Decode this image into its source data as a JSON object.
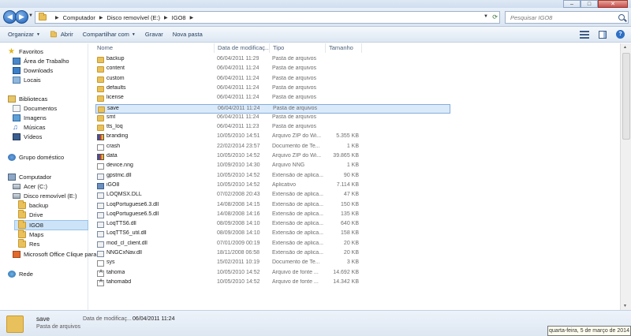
{
  "addressbar": {
    "crumbs": [
      "Computador",
      "Disco removível (E:)",
      "IGO8"
    ],
    "search_placeholder": "Pesquisar IGO8"
  },
  "toolbar": {
    "items": [
      "Organizar",
      "Abrir",
      "Compartilhar com",
      "Gravar",
      "Nova pasta"
    ]
  },
  "window_controls": {
    "minimize": "–",
    "maximize": "□",
    "close": "✕"
  },
  "nav": {
    "favorites": "Favoritos",
    "desktop": "Área de Trabalho",
    "downloads": "Downloads",
    "locais": "Locais",
    "libraries": "Bibliotecas",
    "documents": "Documentos",
    "images": "Imagens",
    "music": "Músicas",
    "videos": "Vídeos",
    "homegroup": "Grupo doméstico",
    "computer": "Computador",
    "drive_c": "Acer (C:)",
    "drive_e": "Disco removível (E:)",
    "folder_backup": "backup",
    "folder_drive": "Drive",
    "folder_igo8": "IGO8",
    "folder_maps": "Maps",
    "folder_res": "Res",
    "office": "Microsoft Office Clique para",
    "network": "Rede"
  },
  "columns": {
    "name": "Nome",
    "date": "Data de modificaç...",
    "type": "Tipo",
    "size": "Tamanho"
  },
  "files": [
    {
      "name": "backup",
      "date": "06/04/2011 11:29",
      "type": "Pasta de arquivos",
      "size": "",
      "icon": "folder-icon"
    },
    {
      "name": "content",
      "date": "06/04/2011 11:24",
      "type": "Pasta de arquivos",
      "size": "",
      "icon": "folder-icon"
    },
    {
      "name": "custom",
      "date": "06/04/2011 11:24",
      "type": "Pasta de arquivos",
      "size": "",
      "icon": "folder-icon"
    },
    {
      "name": "defaults",
      "date": "06/04/2011 11:24",
      "type": "Pasta de arquivos",
      "size": "",
      "icon": "folder-icon"
    },
    {
      "name": "license",
      "date": "06/04/2011 11:24",
      "type": "Pasta de arquivos",
      "size": "",
      "icon": "folder-icon"
    },
    {
      "name": "save",
      "date": "06/04/2011 11:24",
      "type": "Pasta de arquivos",
      "size": "",
      "icon": "folder-icon"
    },
    {
      "name": "smt",
      "date": "06/04/2011 11:24",
      "type": "Pasta de arquivos",
      "size": "",
      "icon": "folder-icon"
    },
    {
      "name": "tts_loq",
      "date": "06/04/2011 11:23",
      "type": "Pasta de arquivos",
      "size": "",
      "icon": "folder-icon"
    },
    {
      "name": "branding",
      "date": "10/05/2010 14:51",
      "type": "Arquivo ZIP do Wi...",
      "size": "5.355 KB",
      "icon": "zip-icon"
    },
    {
      "name": "crash",
      "date": "22/02/2014 23:57",
      "type": "Documento de Te...",
      "size": "1 KB",
      "icon": "text-file-icon"
    },
    {
      "name": "data",
      "date": "10/05/2010 14:52",
      "type": "Arquivo ZIP do Wi...",
      "size": "39.865 KB",
      "icon": "zip-icon"
    },
    {
      "name": "device.nng",
      "date": "10/09/2010 14:30",
      "type": "Arquivo NNG",
      "size": "1 KB",
      "icon": "file-icon"
    },
    {
      "name": "gpstmc.dll",
      "date": "10/05/2010 14:52",
      "type": "Extensão de aplica...",
      "size": "90 KB",
      "icon": "dll-icon"
    },
    {
      "name": "iGO8",
      "date": "10/05/2010 14:52",
      "type": "Aplicativo",
      "size": "7.114 KB",
      "icon": "app-icon"
    },
    {
      "name": "LOQMSX.DLL",
      "date": "07/02/2008 20:43",
      "type": "Extensão de aplica...",
      "size": "47 KB",
      "icon": "dll-icon"
    },
    {
      "name": "LoqPortuguese6.3.dll",
      "date": "14/08/2008 14:15",
      "type": "Extensão de aplica...",
      "size": "150 KB",
      "icon": "dll-icon"
    },
    {
      "name": "LoqPortuguese6.5.dll",
      "date": "14/08/2008 14:16",
      "type": "Extensão de aplica...",
      "size": "135 KB",
      "icon": "dll-icon"
    },
    {
      "name": "LoqTTS6.dll",
      "date": "08/09/2008 14:10",
      "type": "Extensão de aplica...",
      "size": "640 KB",
      "icon": "dll-icon"
    },
    {
      "name": "LoqTTS6_util.dll",
      "date": "08/09/2008 14:10",
      "type": "Extensão de aplica...",
      "size": "158 KB",
      "icon": "dll-icon"
    },
    {
      "name": "mod_cl_client.dll",
      "date": "07/01/2009 00:19",
      "type": "Extensão de aplica...",
      "size": "20 KB",
      "icon": "dll-icon"
    },
    {
      "name": "NNGCxNav.dll",
      "date": "18/11/2008 06:58",
      "type": "Extensão de aplica...",
      "size": "20 KB",
      "icon": "dll-icon"
    },
    {
      "name": "sys",
      "date": "15/02/2011 10:19",
      "type": "Documento de Te...",
      "size": "3 KB",
      "icon": "text-file-icon"
    },
    {
      "name": "tahoma",
      "date": "10/05/2010 14:52",
      "type": "Arquivo de fonte ...",
      "size": "14.692 KB",
      "icon": "font-file-icon"
    },
    {
      "name": "tahomabd",
      "date": "10/05/2010 14:52",
      "type": "Arquivo de fonte ...",
      "size": "14.342 KB",
      "icon": "font-file-icon"
    }
  ],
  "selected_index": 5,
  "details": {
    "name": "save",
    "type": "Pasta de arquivos",
    "date_label": "Data de modificaç...",
    "date": "06/04/2011 11:24"
  },
  "tooltip": "quarta-feira, 5 de março de 2014"
}
